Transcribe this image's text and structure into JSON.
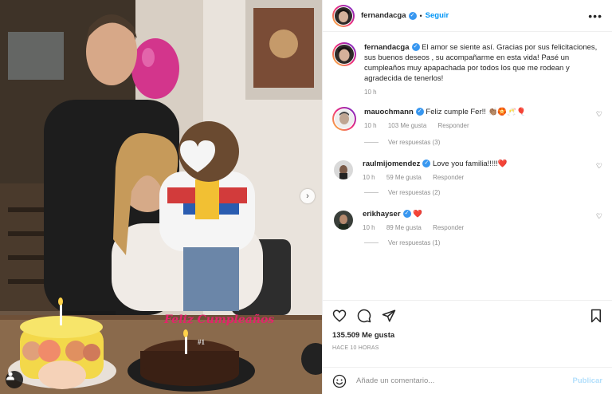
{
  "post": {
    "author": "fernandacga",
    "follow_label": "Seguir",
    "more_label": "•••",
    "next_label": "›"
  },
  "caption": {
    "username": "fernandacga",
    "text": "El amor se siente así. Gracias por sus felicitaciones, sus buenos deseos , su acompañarme en esta vida! Pasé un cumpleaños muy apapachada por todos los que me rodean y agradecida de tenerlos!",
    "time": "10 h"
  },
  "comments": [
    {
      "username": "mauochmann",
      "verified": true,
      "text": "Feliz cumple Fer!! 👏🏽🏵️🥂🎈",
      "time": "10 h",
      "likes": "103 Me gusta",
      "reply": "Responder",
      "replies": "Ver respuestas (3)"
    },
    {
      "username": "raulmijomendez",
      "verified": true,
      "text": "Love you familia!!!!!❤️",
      "time": "10 h",
      "likes": "59 Me gusta",
      "reply": "Responder",
      "replies": "Ver respuestas (2)"
    },
    {
      "username": "erikhayser",
      "verified": true,
      "text": "❤️",
      "time": "10 h",
      "likes": "89 Me gusta",
      "reply": "Responder",
      "replies": "Ver respuestas (1)"
    }
  ],
  "stats": {
    "likes": "135.509 Me gusta",
    "date": "HACE 10 HORAS"
  },
  "composer": {
    "placeholder": "Añade un comentario...",
    "publish": "Publicar"
  },
  "photo": {
    "cake_topper": "Feliz Cumpleaños"
  },
  "colors": {
    "link_blue": "#0095f6",
    "verified_blue": "#3897f0",
    "publish_disabled": "#b2dffc",
    "muted_text": "#8e8e8e"
  }
}
